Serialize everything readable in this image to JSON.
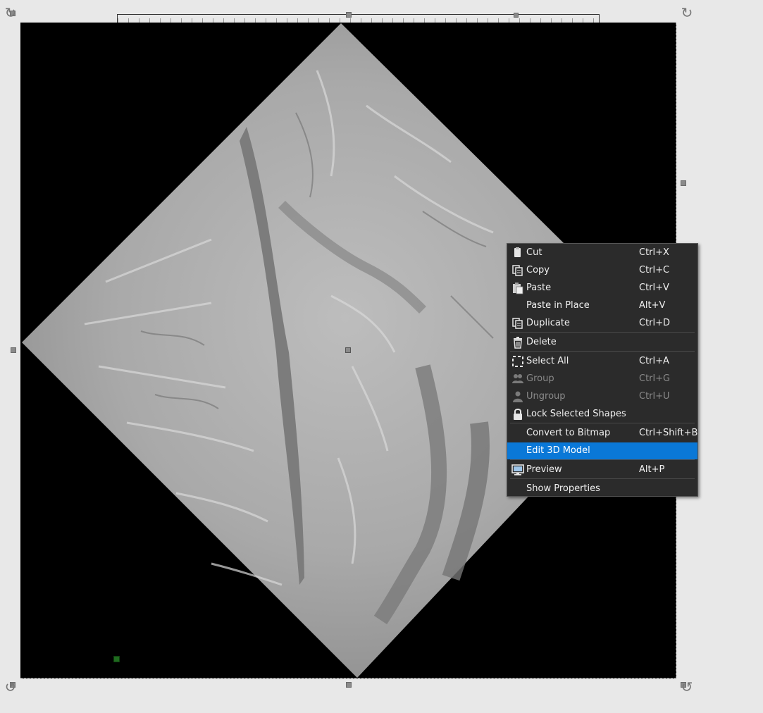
{
  "menu": {
    "items": [
      {
        "label": "Cut",
        "shortcut": "Ctrl+X",
        "icon": "cut-icon",
        "disabled": false
      },
      {
        "label": "Copy",
        "shortcut": "Ctrl+C",
        "icon": "copy-icon",
        "disabled": false
      },
      {
        "label": "Paste",
        "shortcut": "Ctrl+V",
        "icon": "paste-icon",
        "disabled": false
      },
      {
        "label": "Paste in Place",
        "shortcut": "Alt+V",
        "icon": "",
        "disabled": false
      },
      {
        "label": "Duplicate",
        "shortcut": "Ctrl+D",
        "icon": "duplicate-icon",
        "disabled": false
      },
      {
        "label": "Delete",
        "shortcut": "",
        "icon": "trash-icon",
        "disabled": false
      },
      {
        "label": "Select All",
        "shortcut": "Ctrl+A",
        "icon": "select-all-icon",
        "disabled": false
      },
      {
        "label": "Group",
        "shortcut": "Ctrl+G",
        "icon": "group-icon",
        "disabled": true
      },
      {
        "label": "Ungroup",
        "shortcut": "Ctrl+U",
        "icon": "ungroup-icon",
        "disabled": true
      },
      {
        "label": "Lock Selected Shapes",
        "shortcut": "",
        "icon": "lock-icon",
        "disabled": false
      },
      {
        "label": "Convert to Bitmap",
        "shortcut": "Ctrl+Shift+B",
        "icon": "",
        "disabled": false
      },
      {
        "label": "Edit 3D Model",
        "shortcut": "",
        "icon": "",
        "disabled": false,
        "highlighted": true
      },
      {
        "label": "Preview",
        "shortcut": "Alt+P",
        "icon": "monitor-icon",
        "disabled": false
      },
      {
        "label": "Show Properties",
        "shortcut": "",
        "icon": "",
        "disabled": false
      }
    ]
  },
  "colors": {
    "canvas_bg": "#e8e8e8",
    "artwork_bg": "#000000",
    "menu_bg": "#2b2b2b",
    "menu_highlight": "#0a78d7",
    "anchor": "#1f6b1f"
  }
}
